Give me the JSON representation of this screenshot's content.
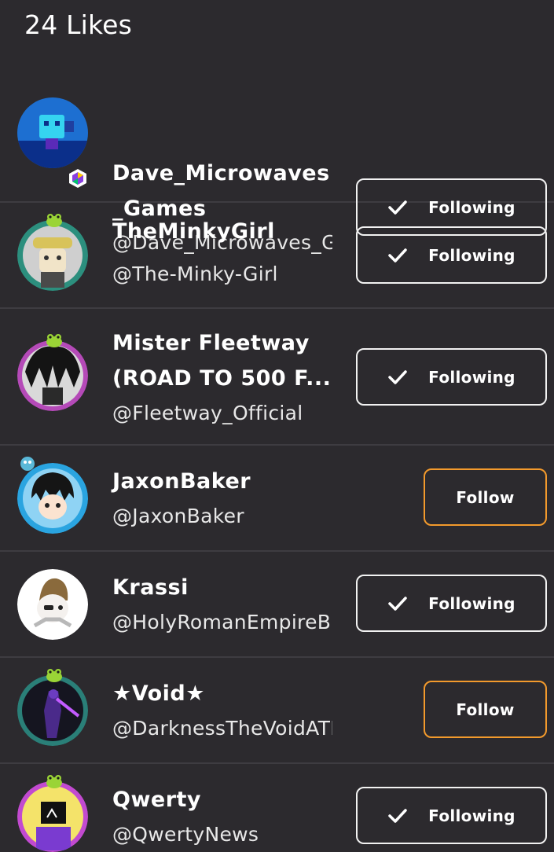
{
  "header": {
    "likes_title": "24 Likes"
  },
  "users": [
    {
      "name_line1": "Dave_Microwaves",
      "name_line2": "_Games",
      "handle": "@Dave_Microwaves_Games",
      "button": "Following",
      "state": "following",
      "avatar_icon": "robot-avatar-icon"
    },
    {
      "name_line1": "TheMinkyGirl",
      "name_line2": "",
      "handle": "@The-Minky-Girl",
      "button": "Following",
      "state": "following",
      "avatar_icon": "girl-avatar-icon"
    },
    {
      "name_line1": "Mister Fleetway",
      "name_line2": "(ROAD TO 500 F...",
      "handle": "@Fleetway_Official",
      "button": "Following",
      "state": "following",
      "avatar_icon": "dark-hair-avatar-icon"
    },
    {
      "name_line1": "JaxonBaker",
      "name_line2": "",
      "handle": "@JaxonBaker",
      "button": "Follow",
      "state": "follow",
      "avatar_icon": "anime-boy-avatar-icon"
    },
    {
      "name_line1": "Krassi",
      "name_line2": "",
      "handle": "@HolyRomanEmpireB",
      "button": "Following",
      "state": "following",
      "avatar_icon": "chibi-avatar-icon"
    },
    {
      "name_line1": "★Void★",
      "name_line2": "",
      "handle": "@DarknessTheVoidATE",
      "button": "Follow",
      "state": "follow",
      "avatar_icon": "void-figure-avatar-icon"
    },
    {
      "name_line1": "Qwerty",
      "name_line2": "",
      "handle": "@QwertyNews",
      "button": "Following",
      "state": "following",
      "avatar_icon": "tv-head-avatar-icon"
    }
  ],
  "colors": {
    "background": "#2c2a2e",
    "divider": "#3e3c41",
    "follow_border": "#f39a2c",
    "following_border": "#f2f2f2"
  }
}
